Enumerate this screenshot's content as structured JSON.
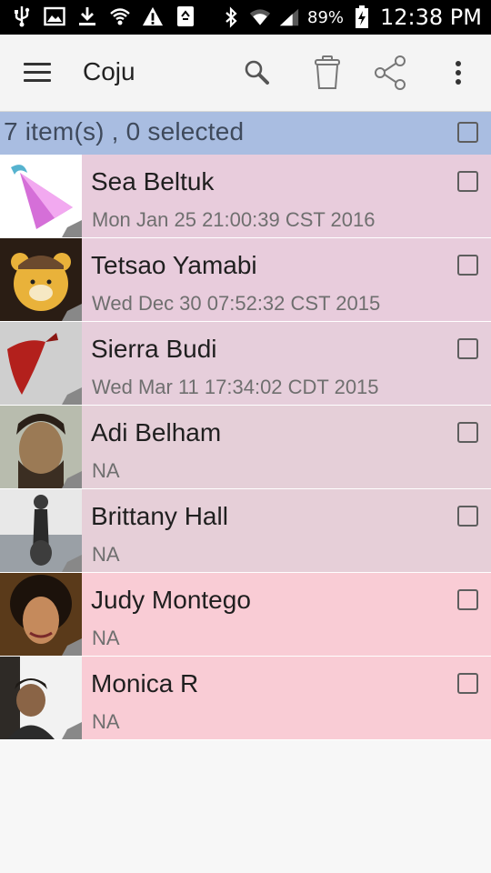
{
  "status_bar": {
    "battery": "89%",
    "time": "12:38 PM",
    "icons": [
      "usb-icon",
      "image-icon",
      "download-icon",
      "hotspot-icon",
      "warning-icon",
      "recycle-icon",
      "bluetooth-icon",
      "wifi-icon",
      "signal-icon",
      "battery-charging-icon"
    ]
  },
  "app_bar": {
    "title": "Coju",
    "actions": [
      "search-icon",
      "trash-icon",
      "share-icon",
      "overflow-menu-icon"
    ]
  },
  "selection_bar": {
    "text": "7 item(s) , 0 selected",
    "checked": false
  },
  "contacts": [
    {
      "name": "Sea Beltuk",
      "date": "Mon Jan 25 21:00:39 CST 2016",
      "bg": "#e8ccdc",
      "checked": false
    },
    {
      "name": "Tetsao Yamabi",
      "date": "Wed Dec 30 07:52:32 CST 2015",
      "bg": "#e8ccdc",
      "checked": false
    },
    {
      "name": "Sierra Budi",
      "date": "Wed Mar 11 17:34:02 CDT 2015",
      "bg": "#e6cedb",
      "checked": false
    },
    {
      "name": "Adi Belham",
      "date": "NA",
      "bg": "#e5cfd8",
      "checked": false
    },
    {
      "name": "Brittany Hall",
      "date": "NA",
      "bg": "#e6cfd8",
      "checked": false
    },
    {
      "name": "Judy Montego",
      "date": "NA",
      "bg": "#f9ccd5",
      "checked": false
    },
    {
      "name": "Monica R",
      "date": "NA",
      "bg": "#f9ccd5",
      "checked": false
    }
  ],
  "colors": {
    "selection_bar": "#a9bde1",
    "status_bar": "#000000",
    "app_bar": "#f4f4f4"
  }
}
